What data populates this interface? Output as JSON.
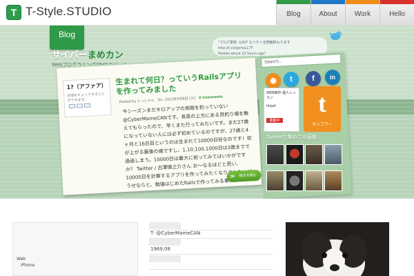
{
  "header": {
    "logo_letter": "T",
    "logo_text": "T-Style.STUDIO",
    "nav": [
      {
        "label": "Blog",
        "top_label": "Blog",
        "color": "#2f9a47"
      },
      {
        "label": "About",
        "top_label": "About",
        "color": "#1f78c8"
      },
      {
        "label": "Work",
        "top_label": "Work",
        "color": "#f08c1a"
      },
      {
        "label": "Hello",
        "top_label": "Hello",
        "color": "#d7322b"
      }
    ]
  },
  "hero": {
    "section_label": "Blog",
    "title_part1": "サイバー",
    "title_part2": "まめカン",
    "subtitle": "Webプログラミング(PHP,Rails,jQuery)やMac,iPad,iPhoneと追い日常。",
    "tweet": {
      "text": "\"ブログ更新: LOST もうすぐ全部観終わります http://t.co/gehyLL7F",
      "time": "Posted about 12 hours ago\""
    },
    "post": {
      "title": "生まれて何日？っていうRailsアプリを作ってみました",
      "meta_by": "Posted by とっしゃん",
      "meta_on": "On: 2012年5月8日 [火]",
      "meta_comments": "0 Comments",
      "body": "今シーズンまだキロアップの鳥賊を釣っていない@CyberMameCANです。長島の上方にある貝釣り場を教えてもらったので、早くまた行ってみたいです。まだ27歳になっていない人には必ず初めているのですが、27歳と4ヶ月と16日目というのは生まれて10000日目なのです！初が上がる最後の歳ですし、1,10,100,1000日は3歳までで過過しまう。10000日は最大に祝ってみてはいかがですか？ Twitter / 古澤慎之介さん お〜なるほどと思い、10000日を計算するアプリを作ってみたくなりました。どうせならと、勉強はじめたRailsで作ってみる事に。",
      "read_more": "続きを読む"
    },
    "qa": {
      "title": "1?（アファア）",
      "subtitle": "日頃をチェックすることができます。"
    },
    "sidebar": {
      "search_placeholder": "Search...",
      "social": [
        {
          "icon": "rss-icon",
          "glyph": "◉",
          "color": "#f08c1a"
        },
        {
          "icon": "twitter-icon",
          "glyph": "t",
          "color": "#2aa9e0"
        },
        {
          "icon": "facebook-icon",
          "glyph": "f",
          "color": "#3b5998"
        },
        {
          "icon": "linkedin-icon",
          "glyph": "in",
          "color": "#1c7fb8"
        }
      ],
      "web_widget_lines": [
        "WEB制作 個人レッスン",
        "httpd"
      ],
      "web_widget_stamp": "募集中",
      "tumblr_letter": "t",
      "tumblr_label": "タンブラー",
      "tumblr_caption": "Tumblrで集めてる画像"
    }
  },
  "bottom": {
    "left_lines": [
      "Web",
      "iPhone"
    ],
    "info": [
      {
        "value": "T-  @CyberMameCAN"
      },
      {
        "value": "1969.08"
      }
    ]
  }
}
